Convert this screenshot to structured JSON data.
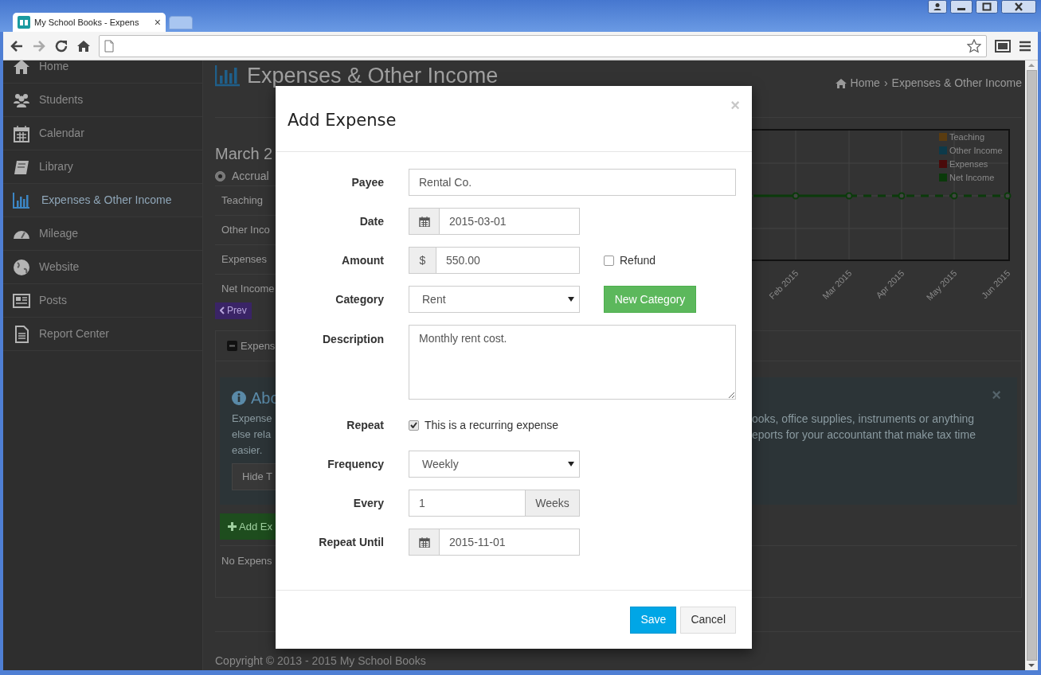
{
  "browser": {
    "tab_title": "My School Books - Expens",
    "tab_close": "×"
  },
  "sidebar": {
    "items": [
      {
        "label": "Home",
        "selected": false
      },
      {
        "label": "Students",
        "selected": false
      },
      {
        "label": "Calendar",
        "selected": false
      },
      {
        "label": "Library",
        "selected": false
      },
      {
        "label": "Expenses & Other Income",
        "selected": true
      },
      {
        "label": "Mileage",
        "selected": false
      },
      {
        "label": "Website",
        "selected": false
      },
      {
        "label": "Posts",
        "selected": false
      },
      {
        "label": "Report Center",
        "selected": false
      }
    ]
  },
  "page": {
    "title": "Expenses & Other Income",
    "breadcrumb": [
      "Home",
      "›",
      "Expenses & Other Income"
    ],
    "period": "March 2",
    "basis": {
      "label": "Accrual",
      "selected": true
    },
    "summary_rows": [
      "Teaching",
      "Other Inco",
      "Expenses",
      "Net Income"
    ],
    "prev_button": "Prev",
    "panel_tab": "Expens",
    "info": {
      "title": "Abo",
      "close": "×",
      "lines_left": [
        "Expense",
        "else rela",
        "easier."
      ],
      "lines_right": [
        "ooks, office supplies, instruments or anything",
        "eports for your accountant that make tax time"
      ],
      "hide_button": "Hide T"
    },
    "add_button": "Add Ex",
    "empty_text": "No Expens",
    "footer": "Copyright © 2013 - 2015 My School Books"
  },
  "chart": {
    "legend": [
      {
        "label": "Teaching",
        "color": "#5a3c10"
      },
      {
        "label": "Other Income",
        "color": "#0d3a4a"
      },
      {
        "label": "Expenses",
        "color": "#4a0a0a"
      },
      {
        "label": "Net Income",
        "color": "#0a3a0a"
      }
    ],
    "x_labels": [
      "Feb 2015",
      "Mar 2015",
      "Apr 2015",
      "May 2015",
      "Jun 2015"
    ]
  },
  "modal": {
    "title": "Add Expense",
    "close": "×",
    "fields": [
      {
        "kind": "text",
        "label": "Payee",
        "value": "Rental Co."
      },
      {
        "kind": "date",
        "label": "Date",
        "value": "2015-03-01"
      },
      {
        "kind": "amount",
        "label": "Amount",
        "prefix": "$",
        "value": "550.00",
        "checkbox": {
          "label": "Refund",
          "checked": false
        }
      },
      {
        "kind": "select",
        "label": "Category",
        "value": "Rent",
        "button": "New Category"
      },
      {
        "kind": "textarea",
        "label": "Description",
        "value": "Monthly rent cost."
      },
      {
        "kind": "checkbox",
        "label": "Repeat",
        "text": "This is a recurring expense",
        "checked": true
      },
      {
        "kind": "select",
        "label": "Frequency",
        "value": "Weekly"
      },
      {
        "kind": "number",
        "label": "Every",
        "value": "1",
        "suffix": "Weeks"
      },
      {
        "kind": "date",
        "label": "Repeat Until",
        "value": "2015-11-01"
      }
    ],
    "buttons": [
      {
        "label": "Save",
        "kind": "primary"
      },
      {
        "label": "Cancel",
        "kind": "default"
      }
    ]
  }
}
